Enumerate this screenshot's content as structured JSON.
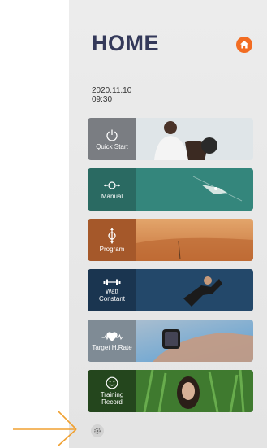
{
  "header": {
    "title": "HOME"
  },
  "datetime": {
    "date": "2020.11.10",
    "time": "09:30"
  },
  "menu": [
    {
      "label": "Quick Start",
      "icon": "power-icon"
    },
    {
      "label": "Manual",
      "icon": "manual-dial-icon"
    },
    {
      "label": "Program",
      "icon": "program-icon"
    },
    {
      "label": "Watt Constant",
      "icon": "dumbbell-icon"
    },
    {
      "label": "Target H.Rate",
      "icon": "heart-rate-icon"
    },
    {
      "label": "Training Record",
      "icon": "smiley-icon"
    }
  ],
  "colors": {
    "accent": "#f26c22",
    "title": "#34395a",
    "arrow": "#f0a030"
  }
}
